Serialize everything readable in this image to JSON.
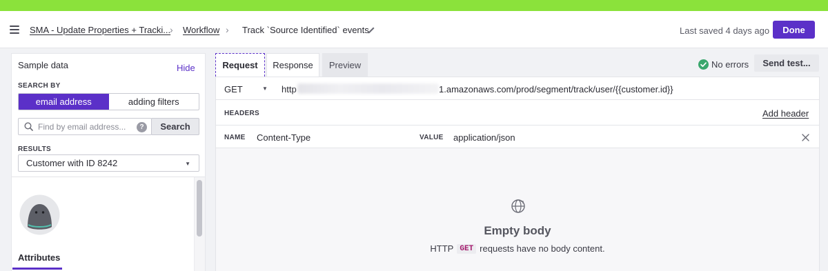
{
  "header": {
    "crumbs": [
      {
        "label": "SMA - Update Properties + Tracki..."
      },
      {
        "label": "Workflow"
      },
      {
        "label": "Track `Source Identified` events"
      }
    ],
    "separator": "›",
    "last_saved": "Last saved 4 days ago",
    "done_label": "Done"
  },
  "sample_data": {
    "title": "Sample data",
    "hide_label": "Hide",
    "search_by_label": "SEARCH BY",
    "search_modes": [
      "email address",
      "adding filters"
    ],
    "active_mode": "email address",
    "search_placeholder": "Find by email address...",
    "search_button": "Search",
    "help_glyph": "?",
    "results_label": "RESULTS",
    "results_value": "Customer with ID 8242",
    "attributes_tab": "Attributes"
  },
  "request": {
    "tabs": [
      "Request",
      "Response",
      "Preview"
    ],
    "active_tab": "Request",
    "status": "No errors",
    "send_test_label": "Send test...",
    "method": "GET",
    "url_prefix": "http",
    "url_suffix": "1.amazonaws.com/prod/segment/track/user/{{customer.id}}",
    "headers_label": "HEADERS",
    "add_header_label": "Add header",
    "header_name_label": "NAME",
    "header_name": "Content-Type",
    "header_value_label": "VALUE",
    "header_value": "application/json",
    "empty_title": "Empty body",
    "empty_desc_pre": "HTTP",
    "empty_desc_code": "GET",
    "empty_desc_post": "requests have no body content."
  },
  "colors": {
    "accent": "#5b30c8",
    "top_strip": "#8be23b",
    "success": "#3aa76d"
  },
  "icons": [
    "menu-icon",
    "pencil-icon",
    "search-icon",
    "help-icon",
    "chevron-down-icon",
    "check-circle-icon",
    "close-icon",
    "globe-icon",
    "avatar-icon"
  ]
}
